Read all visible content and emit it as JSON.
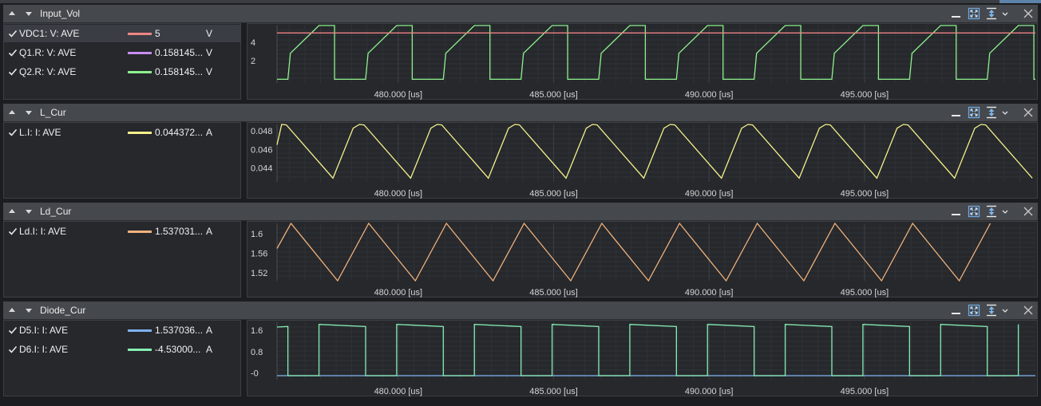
{
  "axis": {
    "x_ticks": [
      {
        "value": 480,
        "label": "480.000 [us]"
      },
      {
        "value": 485,
        "label": "485.000 [us]"
      },
      {
        "value": 490,
        "label": "490.000 [us]"
      },
      {
        "value": 495,
        "label": "495.000 [us]"
      }
    ],
    "x_range_us": [
      476.1,
      500.5
    ],
    "period_us": 2.5
  },
  "panels": [
    {
      "title": "Input_Vol",
      "y_range": [
        -0.4,
        5.8
      ],
      "y_ticks": [
        {
          "value": 4,
          "label": "4"
        },
        {
          "value": 2,
          "label": "2"
        }
      ],
      "signals": [
        {
          "name": "VDC1: V: AVE",
          "value": "5",
          "unit": "V",
          "color": "#f08585",
          "selected": true
        },
        {
          "name": "Q1.R: V: AVE",
          "value": "0.158145...",
          "unit": "V",
          "color": "#c78df0",
          "selected": false
        },
        {
          "name": "Q2.R: V: AVE",
          "value": "0.158145...",
          "unit": "V",
          "color": "#8ef08c",
          "selected": false
        }
      ]
    },
    {
      "title": "L_Cur",
      "y_range": [
        0.0425,
        0.0487
      ],
      "y_ticks": [
        {
          "value": 0.048,
          "label": "0.048"
        },
        {
          "value": 0.046,
          "label": "0.046"
        },
        {
          "value": 0.044,
          "label": "0.044"
        }
      ],
      "signals": [
        {
          "name": "L.I: I: AVE",
          "value": "0.044372...",
          "unit": "A",
          "color": "#f5f08a",
          "selected": false
        }
      ]
    },
    {
      "title": "Ld_Cur",
      "y_range": [
        1.504,
        1.6215
      ],
      "y_ticks": [
        {
          "value": 1.6,
          "label": "1.6"
        },
        {
          "value": 1.56,
          "label": "1.56"
        },
        {
          "value": 1.52,
          "label": "1.52"
        }
      ],
      "signals": [
        {
          "name": "Ld.I: I: AVE",
          "value": "1.537031...",
          "unit": "A",
          "color": "#f2b27c",
          "selected": false
        }
      ]
    },
    {
      "title": "Diode_Cur",
      "y_range": [
        -0.25,
        1.9
      ],
      "y_ticks": [
        {
          "value": 1.6,
          "label": "1.6"
        },
        {
          "value": 0.8,
          "label": "0.8"
        },
        {
          "value": 0,
          "label": "-0"
        }
      ],
      "signals": [
        {
          "name": "D5.I: I: AVE",
          "value": "1.537036...",
          "unit": "A",
          "color": "#7fb2ee",
          "selected": false
        },
        {
          "name": "D6.I: I: AVE",
          "value": "-4.53000...",
          "unit": "A",
          "color": "#86eeb4",
          "selected": false
        }
      ]
    }
  ],
  "icons": {
    "collapse": "triangle-up-icon",
    "expand": "triangle-down-icon",
    "minimize": "minimize-icon",
    "fit": "fit-view-icon",
    "autoscale": "autoscale-icon",
    "menu": "chevron-down-icon",
    "close": "close-icon"
  }
}
